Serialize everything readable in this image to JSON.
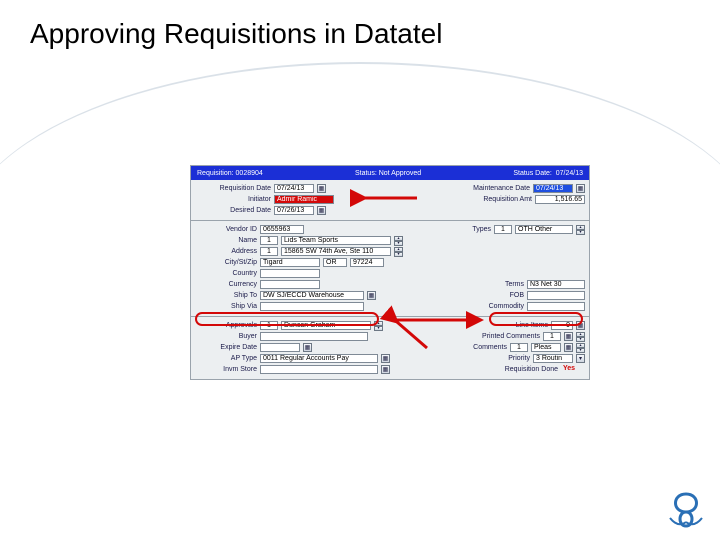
{
  "slide": {
    "title": "Approving Requisitions in Datatel"
  },
  "header": {
    "req_label": "Requisition:",
    "req_no": "0028904",
    "status_label": "Status:",
    "status_val": "Not Approved",
    "status_date_label": "Status Date:",
    "status_date": "07/24/13"
  },
  "top": {
    "req_date_label": "Requisition Date",
    "req_date": "07/24/13",
    "maint_date_label": "Maintenance Date",
    "maint_date": "07/24/13",
    "initiator_label": "Initiator",
    "initiator": "Admir Ramic",
    "req_amt_label": "Requisition Amt",
    "req_amt": "1,516.65",
    "desired_date_label": "Desired Date",
    "desired_date": "07/26/13"
  },
  "vendor": {
    "id_label": "Vendor ID",
    "id": "0655963",
    "types_label": "Types",
    "types_no": "1",
    "types_val": "OTH Other",
    "name_label": "Name",
    "name_no": "1",
    "name_val": "Lids Team Sports",
    "addr_label": "Address",
    "addr_no": "1",
    "addr_val": "15865 SW 74th Ave, Ste 110",
    "city_label": "City/St/Zip",
    "city": "Tigard",
    "st": "OR",
    "zip": "97224",
    "country_label": "Country",
    "currency_label": "Currency",
    "terms_label": "Terms",
    "terms_val": "N3 Net 30",
    "shipto_label": "Ship To",
    "shipto_val": "DW SJ/ECCD Warehouse",
    "fob_label": "FOB",
    "shipvia_label": "Ship Via",
    "commodity_label": "Commodity"
  },
  "bottom": {
    "approvals_label": "Approvals",
    "approvals_no": "1",
    "approvals_val": "Duncan Graham",
    "line_items_label": "Line Items",
    "line_items_val": "9",
    "buyer_label": "Buyer",
    "printed_label": "Printed Comments",
    "printed_val": "1",
    "expire_label": "Expire Date",
    "comments_label": "Comments",
    "comments_no": "1",
    "comments_val": "Pleas",
    "aptype_label": "AP Type",
    "aptype_val": "0011 Regular Accounts Pay",
    "priority_label": "Priority",
    "priority_val": "3 Routin",
    "invm_label": "Invm Store",
    "reqdone_label": "Requisition Done",
    "reqdone_val": "Yes"
  }
}
